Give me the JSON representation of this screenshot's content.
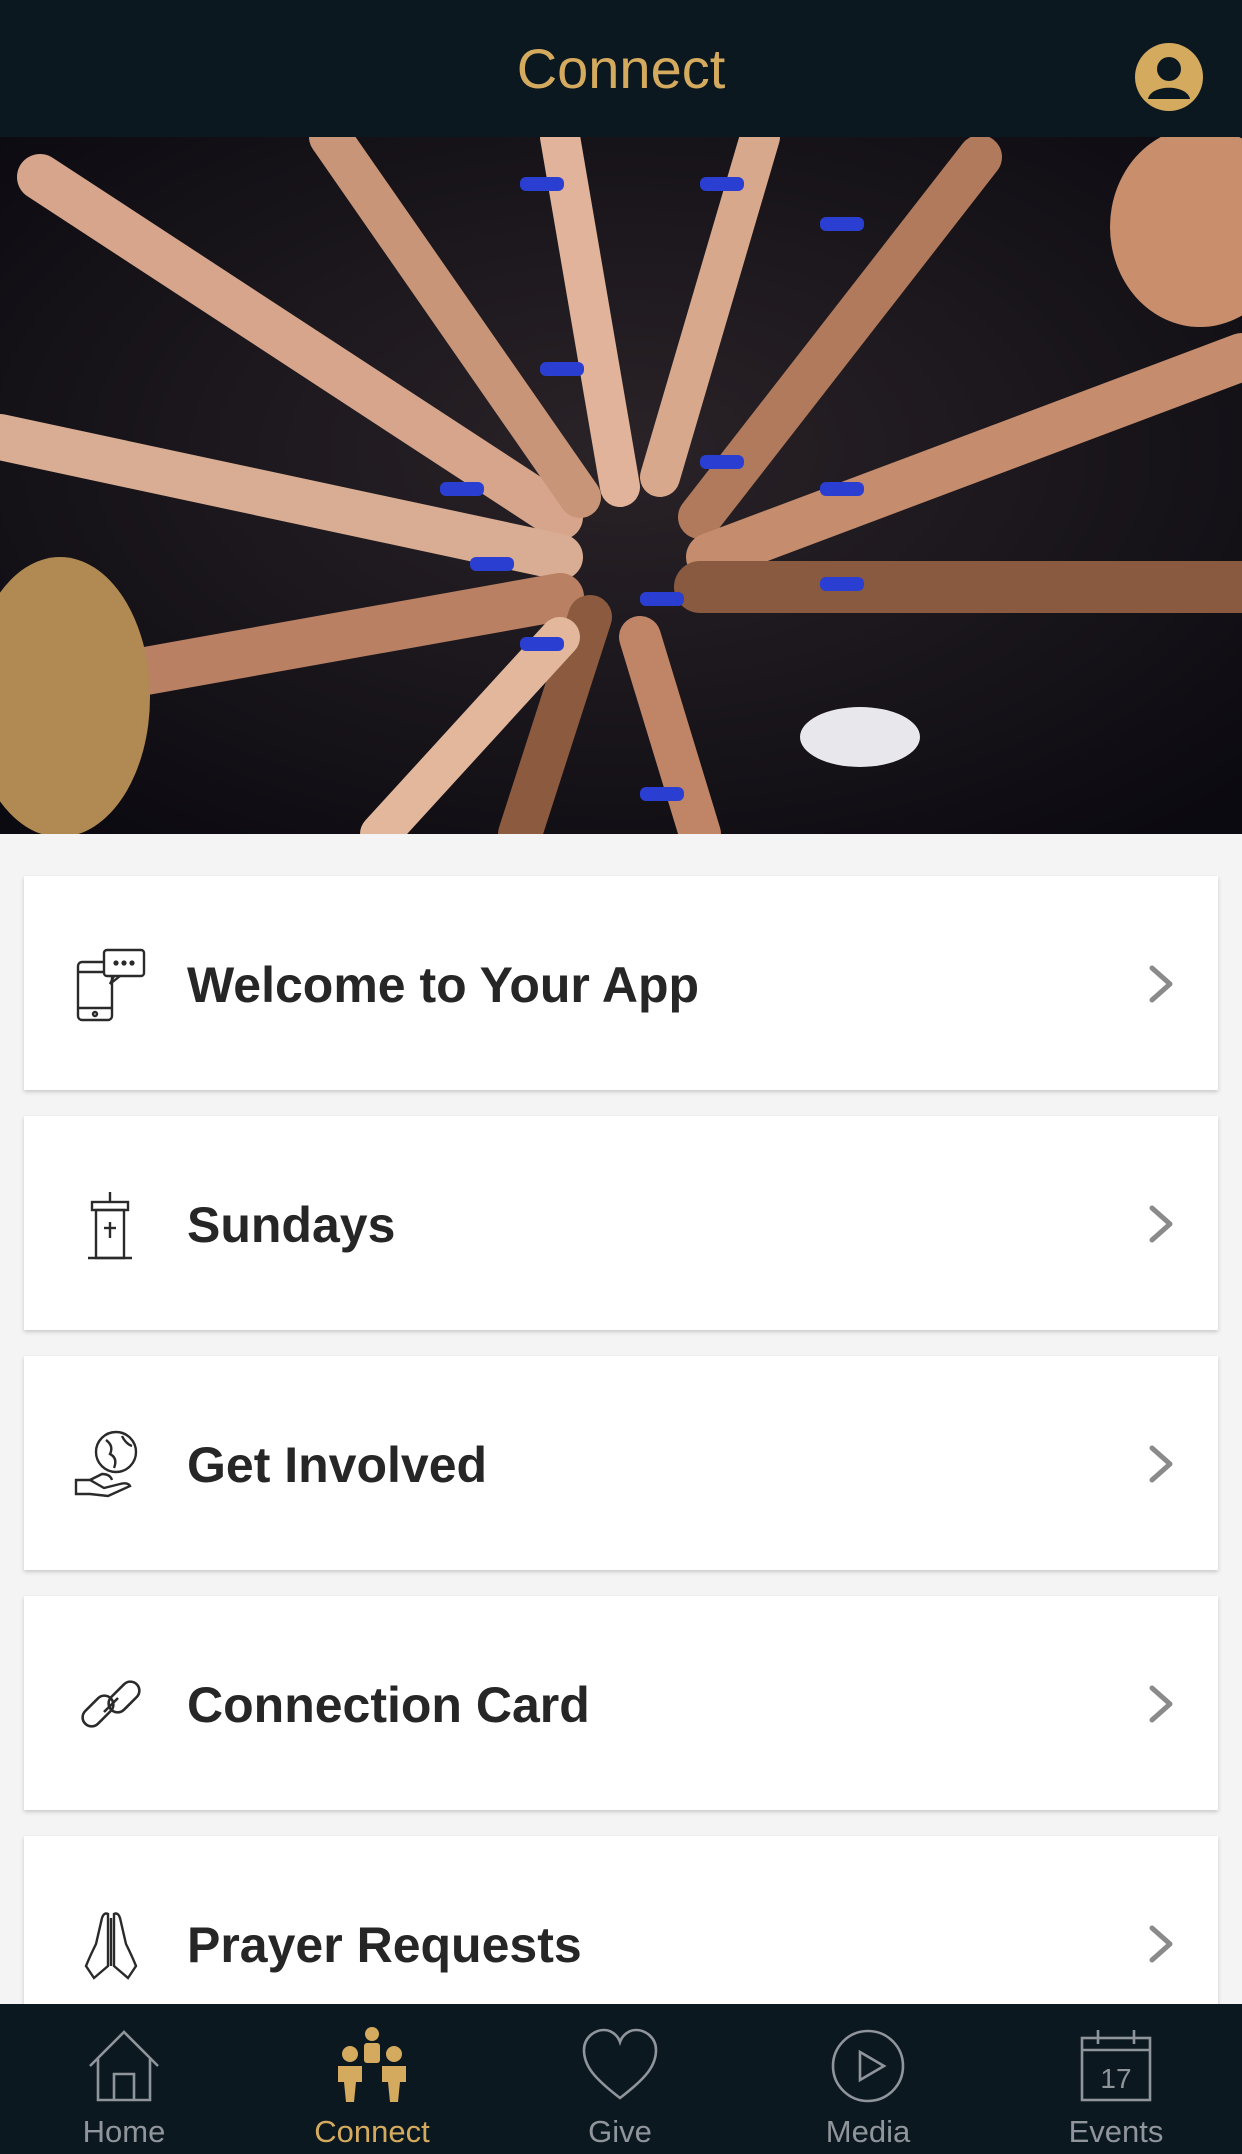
{
  "header": {
    "title": "Connect",
    "profile_icon": "profile-icon"
  },
  "hero": {
    "description_icon": "group-hands-photo"
  },
  "menu": {
    "items": [
      {
        "label": "Welcome to Your App",
        "icon": "phone-chat-icon"
      },
      {
        "label": "Sundays",
        "icon": "pulpit-icon"
      },
      {
        "label": "Get Involved",
        "icon": "globe-hand-icon"
      },
      {
        "label": "Connection Card",
        "icon": "link-icon"
      },
      {
        "label": "Prayer Requests",
        "icon": "praying-hands-icon"
      }
    ]
  },
  "tabbar": {
    "tabs": [
      {
        "label": "Home",
        "icon": "home-icon",
        "active": false
      },
      {
        "label": "Connect",
        "icon": "people-icon",
        "active": true
      },
      {
        "label": "Give",
        "icon": "heart-icon",
        "active": false
      },
      {
        "label": "Media",
        "icon": "play-icon",
        "active": false
      },
      {
        "label": "Events",
        "icon": "calendar-icon",
        "active": false,
        "calendar_day": "17"
      }
    ]
  },
  "colors": {
    "accent": "#d4aa5e",
    "bar_bg": "#0c1820",
    "page_bg": "#f4f4f4",
    "inactive": "#8f959a"
  }
}
